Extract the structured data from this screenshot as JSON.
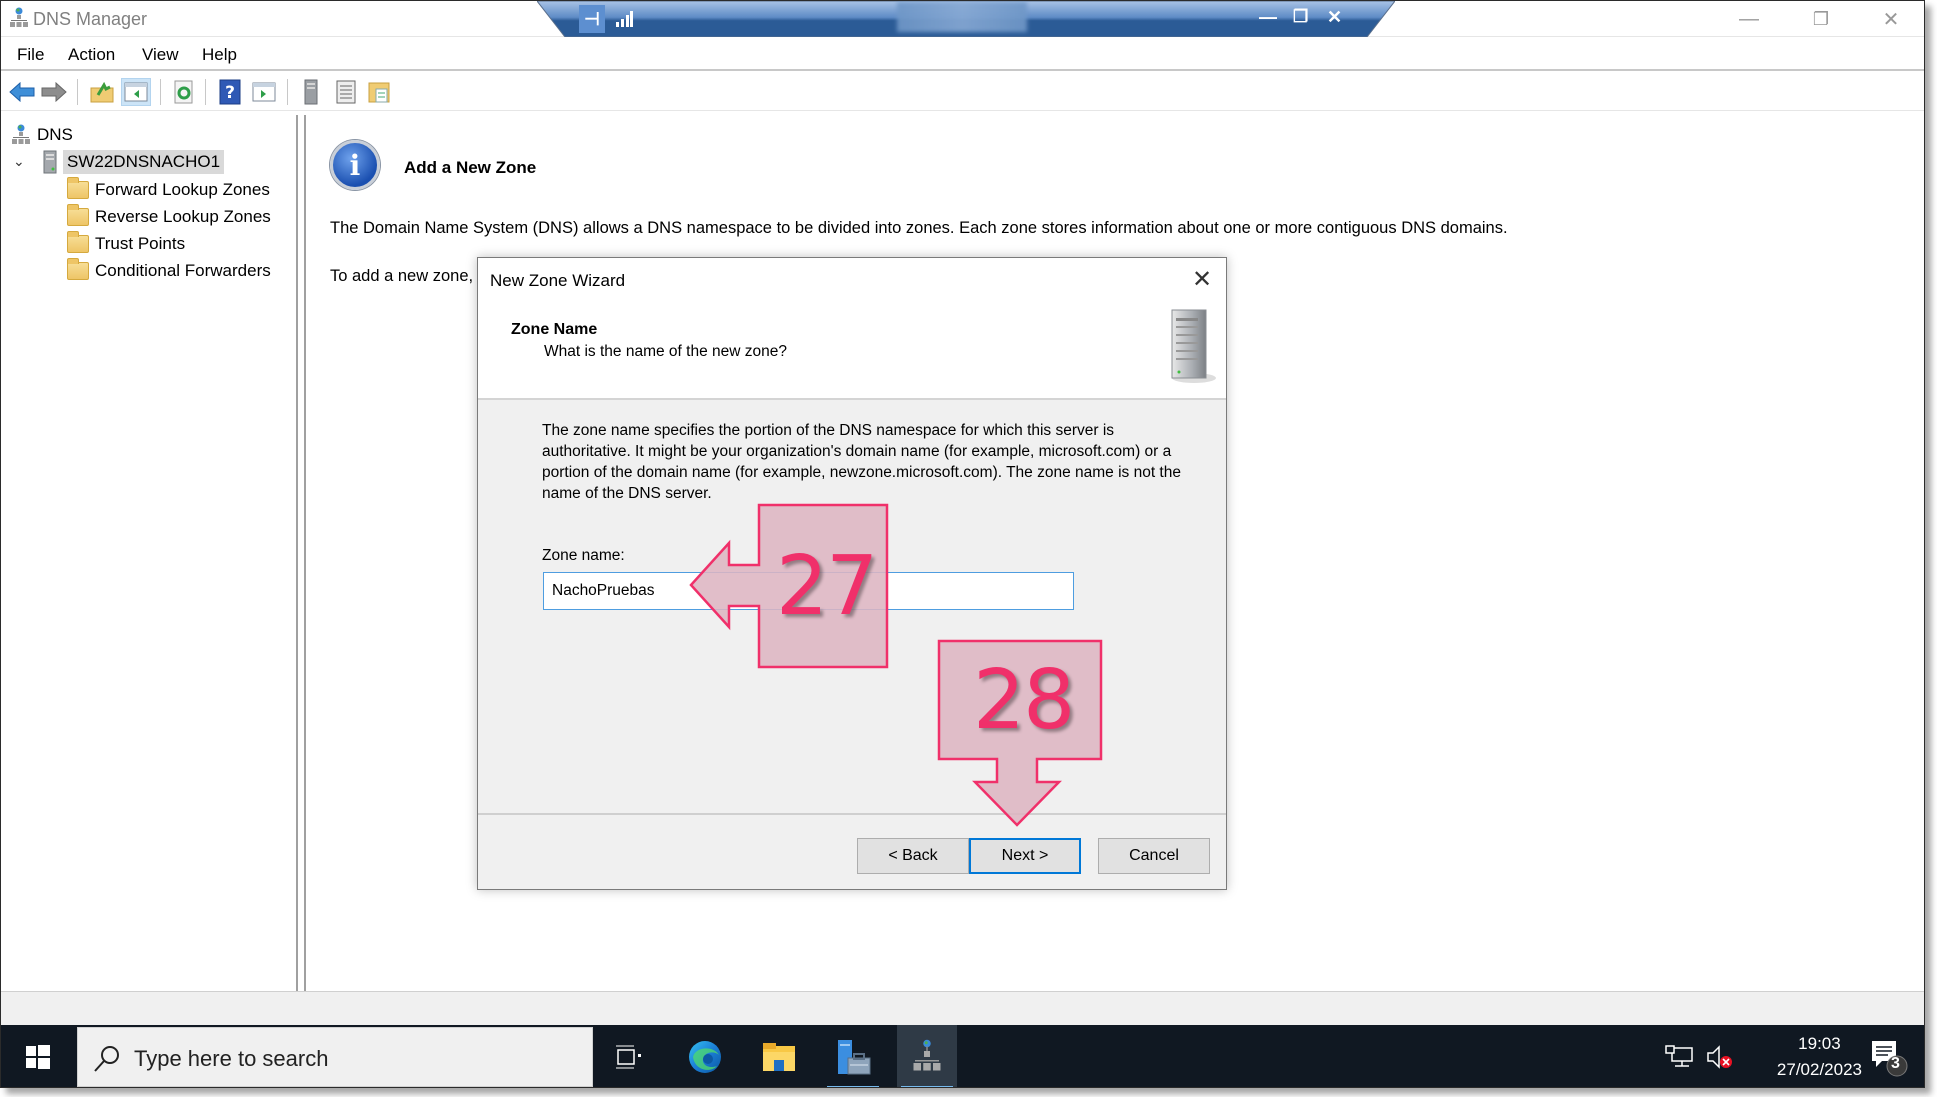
{
  "window": {
    "title": "DNS Manager",
    "controls": {
      "minimize": "—",
      "restore": "❐",
      "close": "✕"
    }
  },
  "rdp_bar": {
    "pin_icon": "pin-icon",
    "signal_icon": "connection-quality-icon",
    "minimize": "—",
    "restore": "❐",
    "close": "✕"
  },
  "menu": {
    "items": [
      {
        "label": "File"
      },
      {
        "label": "Action"
      },
      {
        "label": "View"
      },
      {
        "label": "Help"
      }
    ]
  },
  "toolbar": {
    "buttons": [
      {
        "name": "back-icon"
      },
      {
        "name": "forward-icon"
      },
      {
        "name": "up-folder-icon"
      },
      {
        "name": "show-hide-console-tree-icon",
        "active": true
      },
      {
        "name": "refresh-icon"
      },
      {
        "name": "help-icon"
      },
      {
        "name": "show-hide-action-pane-icon"
      },
      {
        "name": "server-icon"
      },
      {
        "name": "list-icon"
      },
      {
        "name": "properties-icon"
      }
    ]
  },
  "tree": {
    "root": "DNS",
    "server": "SW22DNSNACHO1",
    "children": [
      {
        "label": "Forward Lookup Zones"
      },
      {
        "label": "Reverse Lookup Zones"
      },
      {
        "label": "Trust Points"
      },
      {
        "label": "Conditional Forwarders"
      }
    ]
  },
  "content": {
    "title": "Add a New Zone",
    "paragraph1": "The Domain Name System (DNS) allows a DNS namespace to be divided into zones. Each zone stores information about one or more contiguous DNS domains.",
    "paragraph2": "To add a new zone,"
  },
  "dialog": {
    "title": "New Zone Wizard",
    "close": "✕",
    "header_title": "Zone Name",
    "header_subtitle": "What is the name of the new zone?",
    "description": "The zone name specifies the portion of the DNS namespace for which this server is authoritative. It might be your organization's domain name (for example,  microsoft.com) or a portion of the domain name (for example, newzone.microsoft.com). The zone name is not the name of the DNS server.",
    "zone_name_label": "Zone name:",
    "zone_name_value": "NachoPruebas",
    "buttons": {
      "back": "< Back",
      "next": "Next >",
      "cancel": "Cancel"
    }
  },
  "annotations": [
    {
      "number": "27",
      "points_to": "zone-name-input",
      "direction": "left"
    },
    {
      "number": "28",
      "points_to": "next-button",
      "direction": "down"
    }
  ],
  "taskbar": {
    "search_placeholder": "Type here to search",
    "apps": [
      {
        "name": "task-view-icon"
      },
      {
        "name": "edge-icon"
      },
      {
        "name": "file-explorer-icon"
      },
      {
        "name": "server-manager-icon",
        "open": true
      },
      {
        "name": "dns-manager-icon",
        "open": true,
        "active": true
      }
    ],
    "time": "19:03",
    "date": "27/02/2023",
    "notification_count": "3"
  },
  "colors": {
    "annotation": "#f0306a",
    "annotation_fill": "#ddb5c2",
    "focus_blue": "#0078d7",
    "taskbar": "#101822",
    "rdp_bar": "#2b5b96"
  }
}
